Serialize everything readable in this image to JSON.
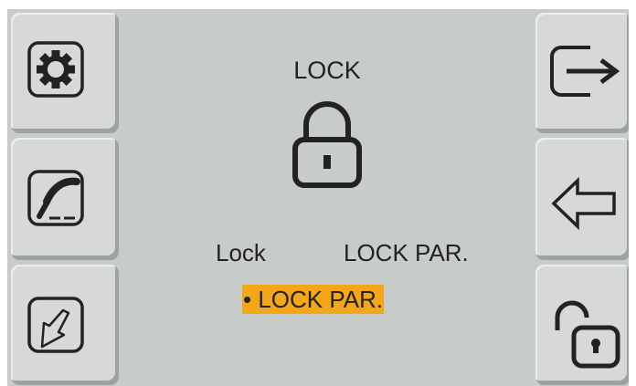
{
  "screen": {
    "title": "LOCK",
    "options": {
      "left_label": "Lock",
      "right_label": "LOCK PAR.",
      "selected": "• LOCK PAR."
    }
  },
  "colors": {
    "background": "#c8ccc9",
    "button": "#d6d9d7",
    "highlight": "#f2a618",
    "icon": "#222222"
  },
  "left_buttons": [
    {
      "icon": "gear-icon"
    },
    {
      "icon": "welding-torch-icon"
    },
    {
      "icon": "down-arrow-icon"
    }
  ],
  "right_buttons": [
    {
      "icon": "exit-icon"
    },
    {
      "icon": "back-arrow-icon"
    },
    {
      "icon": "unlock-icon"
    }
  ]
}
